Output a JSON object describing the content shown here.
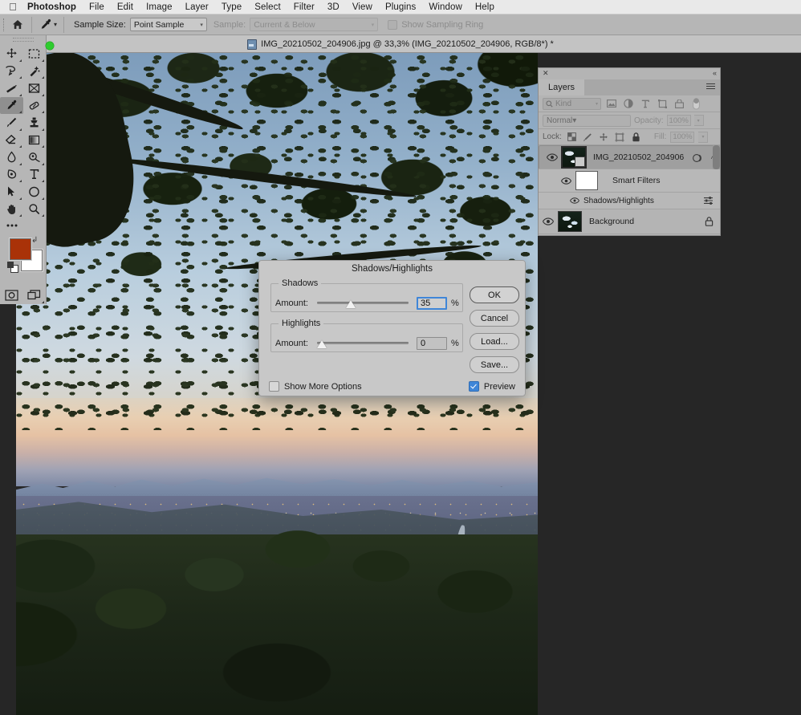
{
  "menubar": {
    "apple_icon": "apple-logo-icon",
    "items": [
      {
        "label": "Photoshop",
        "bold": true
      },
      {
        "label": "File"
      },
      {
        "label": "Edit"
      },
      {
        "label": "Image"
      },
      {
        "label": "Layer"
      },
      {
        "label": "Type"
      },
      {
        "label": "Select"
      },
      {
        "label": "Filter"
      },
      {
        "label": "3D"
      },
      {
        "label": "View"
      },
      {
        "label": "Plugins"
      },
      {
        "label": "Window"
      },
      {
        "label": "Help"
      }
    ]
  },
  "options_bar": {
    "home_icon": "home-icon",
    "tool_icon": "eyedropper-icon",
    "tool_chevron": "chevron-down-icon",
    "sample_size_label": "Sample Size:",
    "sample_size_value": "Point Sample",
    "sample_label": "Sample:",
    "sample_value": "Current & Below",
    "show_sampling_ring_label": "Show Sampling Ring",
    "show_sampling_ring_checked": false
  },
  "document_tab": {
    "title": "IMG_20210502_204906.jpg @ 33,3% (IMG_20210502_204906, RGB/8*) *",
    "doc_icon": "document-icon",
    "collapse_icon": "collapse-left-icon"
  },
  "toolbar": {
    "rows": [
      [
        {
          "name": "move-tool",
          "icon": "move-icon",
          "active": false,
          "corner": true
        },
        {
          "name": "marquee-tool",
          "icon": "rectangular-marquee-icon",
          "active": false,
          "corner": true
        }
      ],
      [
        {
          "name": "lasso-tool",
          "icon": "lasso-icon",
          "active": false,
          "corner": true
        },
        {
          "name": "magic-wand-tool",
          "icon": "magic-wand-icon",
          "active": false,
          "corner": true
        }
      ],
      [
        {
          "name": "crop-tool",
          "icon": "crop-icon",
          "active": false,
          "corner": true
        },
        {
          "name": "frame-tool",
          "icon": "frame-icon",
          "active": false,
          "corner": true
        }
      ],
      [
        {
          "name": "eyedropper-tool",
          "icon": "eyedropper-icon",
          "active": true,
          "corner": true
        },
        {
          "name": "healing-brush-tool",
          "icon": "healing-brush-icon",
          "active": false,
          "corner": true
        }
      ],
      [
        {
          "name": "brush-tool",
          "icon": "brush-icon",
          "active": false,
          "corner": true
        },
        {
          "name": "clone-stamp-tool",
          "icon": "clone-stamp-icon",
          "active": false,
          "corner": true
        }
      ],
      [
        {
          "name": "eraser-tool",
          "icon": "eraser-icon",
          "active": false,
          "corner": true
        },
        {
          "name": "gradient-tool",
          "icon": "gradient-icon",
          "active": false,
          "corner": true
        }
      ],
      [
        {
          "name": "blur-tool",
          "icon": "blur-droplet-icon",
          "active": false,
          "corner": true
        },
        {
          "name": "dodge-tool",
          "icon": "dodge-icon",
          "active": false,
          "corner": true
        }
      ],
      [
        {
          "name": "pen-tool",
          "icon": "pen-icon",
          "active": false,
          "corner": true
        },
        {
          "name": "type-tool",
          "icon": "type-t-icon",
          "active": false,
          "corner": true
        }
      ],
      [
        {
          "name": "path-selection-tool",
          "icon": "path-arrow-icon",
          "active": false,
          "corner": true
        },
        {
          "name": "ellipse-tool",
          "icon": "ellipse-icon",
          "active": false,
          "corner": true
        }
      ],
      [
        {
          "name": "hand-tool",
          "icon": "hand-icon",
          "active": false,
          "corner": true
        },
        {
          "name": "zoom-tool",
          "icon": "magnifier-icon",
          "active": false,
          "corner": true
        }
      ]
    ],
    "edit_toolbar_icon": "ellipsis-icon",
    "foreground_color": "#a93208",
    "background_color": "#ffffff",
    "swap_icon": "swap-colors-icon",
    "default_colors_icon": "default-colors-icon",
    "quick_mask_icon": "quick-mask-icon",
    "screen_mode_icon": "screen-mode-icon"
  },
  "layers_panel": {
    "close_icon": "close-icon",
    "collapse_icon": "collapse-right-icon",
    "tab_label": "Layers",
    "menu_icon": "panel-menu-icon",
    "filter": {
      "search_icon": "search-icon",
      "kind_label": "Kind",
      "chevron_icon": "chevron-down-icon",
      "icons": [
        "pixel-layer-icon",
        "adjustment-layer-icon",
        "type-layer-icon",
        "shape-layer-icon",
        "smart-object-icon"
      ],
      "toggle_icon": "filter-toggle-icon"
    },
    "blend_mode": "Normal",
    "opacity_label": "Opacity:",
    "opacity_value": "100%",
    "lock_label": "Lock:",
    "lock_icons": [
      "lock-transparency-icon",
      "lock-image-icon",
      "lock-position-icon",
      "lock-artboard-icon",
      "lock-all-icon"
    ],
    "fill_label": "Fill:",
    "fill_value": "100%",
    "layers": [
      {
        "name": "IMG_20210502_204906",
        "type": "smart-object",
        "visible": true,
        "selected": true,
        "eye_icon": "eye-icon",
        "thumbnail": "photo-thumbnail",
        "badge_icon": "smart-object-badge-icon",
        "right_icon": "smart-filter-indicator-icon",
        "expand_icon": "chevron-up-icon"
      },
      {
        "name": "Smart Filters",
        "type": "smart-filter-group",
        "visible": true,
        "eye_icon": "eye-icon",
        "thumbnail": "white-mask-thumbnail"
      },
      {
        "name": "Shadows/Highlights",
        "type": "smart-filter",
        "visible": true,
        "eye_icon": "eye-icon",
        "right_icon": "filter-settings-icon"
      },
      {
        "name": "Background",
        "type": "background",
        "visible": true,
        "locked": true,
        "eye_icon": "eye-icon",
        "thumbnail": "photo-thumbnail",
        "right_icon": "lock-icon"
      }
    ]
  },
  "dialog": {
    "title": "Shadows/Highlights",
    "shadows": {
      "group_label": "Shadows",
      "amount_label": "Amount:",
      "value": "35",
      "unit": "%",
      "slider_percent": 35,
      "focused": true
    },
    "highlights": {
      "group_label": "Highlights",
      "amount_label": "Amount:",
      "value": "0",
      "unit": "%",
      "slider_percent": 0,
      "focused": false
    },
    "buttons": [
      {
        "label": "OK",
        "name": "ok-button",
        "default": true
      },
      {
        "label": "Cancel",
        "name": "cancel-button",
        "default": false
      },
      {
        "label": "Load...",
        "name": "load-button",
        "default": false
      },
      {
        "label": "Save...",
        "name": "save-button",
        "default": false
      }
    ],
    "show_more_options_label": "Show More Options",
    "show_more_options_checked": false,
    "preview_label": "Preview",
    "preview_checked": true,
    "accent_color": "#3f86d8"
  }
}
